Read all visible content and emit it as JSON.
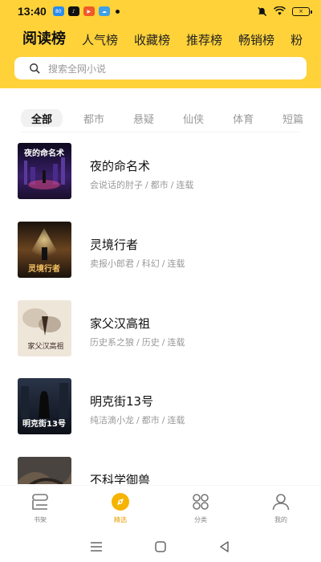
{
  "status_bar": {
    "time": "13:40",
    "apps": [
      {
        "name": "app-icon-blue",
        "label": "80",
        "color": "#2a8cf0"
      },
      {
        "name": "tiktok-icon",
        "label": "♪",
        "color": "#111111"
      },
      {
        "name": "video-app-icon",
        "label": "▶",
        "color": "#f05a28"
      },
      {
        "name": "cloud-app-icon",
        "label": "☁",
        "color": "#3fa0e8"
      }
    ],
    "battery": "×"
  },
  "rank_tabs": [
    "阅读榜",
    "人气榜",
    "收藏榜",
    "推荐榜",
    "畅销榜",
    "粉"
  ],
  "active_rank_tab": 0,
  "search": {
    "placeholder": "搜索全网小说"
  },
  "categories": [
    "全部",
    "都市",
    "悬疑",
    "仙侠",
    "体育",
    "短篇"
  ],
  "active_category": 0,
  "books": [
    {
      "title": "夜的命名术",
      "author": "会说话的肘子",
      "genre": "都市",
      "status": "连载",
      "cover_text": "夜的命名术",
      "cover_colors": [
        "#1a1030",
        "#6b3aa0",
        "#e84a8a"
      ]
    },
    {
      "title": "灵境行者",
      "author": "卖报小郎君",
      "genre": "科幻",
      "status": "连载",
      "cover_text": "灵境行者",
      "cover_colors": [
        "#2a1d14",
        "#c8843a",
        "#f4c060"
      ]
    },
    {
      "title": "家父汉高祖",
      "author": "历史系之狼",
      "genre": "历史",
      "status": "连载",
      "cover_text": "家父汉高祖",
      "cover_colors": [
        "#efe6da",
        "#b9a48c",
        "#5a4638"
      ]
    },
    {
      "title": "明克街13号",
      "author": "纯洁滴小龙",
      "genre": "都市",
      "status": "连载",
      "cover_text": "明克街13号",
      "cover_colors": [
        "#141a24",
        "#3a4a62",
        "#c84a3a"
      ]
    },
    {
      "title": "不科学御兽",
      "author": "",
      "genre": "",
      "status": "",
      "cover_text": "",
      "cover_colors": [
        "#3a3a3a",
        "#6a5a4a",
        "#a08a6a"
      ]
    }
  ],
  "bottom_nav": [
    {
      "label": "书架",
      "icon": "bookshelf-icon"
    },
    {
      "label": "精选",
      "icon": "compass-icon"
    },
    {
      "label": "分类",
      "icon": "category-grid-icon"
    },
    {
      "label": "我的",
      "icon": "profile-icon"
    }
  ],
  "active_nav": 1,
  "colors": {
    "header": "#ffd23a",
    "accent": "#e8a000",
    "tab_indicator": "#e8762d"
  }
}
